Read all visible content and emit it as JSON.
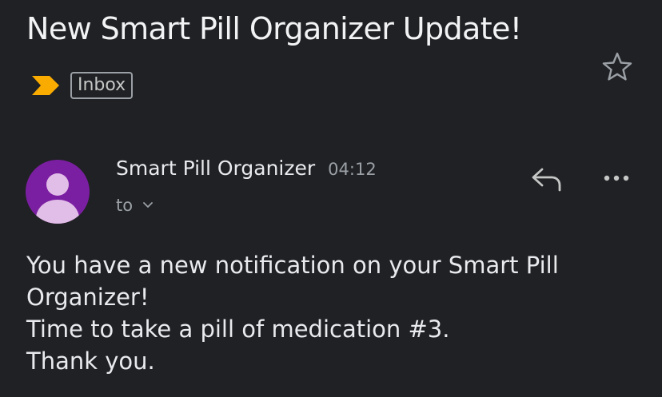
{
  "email": {
    "subject": "New Smart Pill Organizer Update!",
    "label": "Inbox",
    "sender": "Smart Pill Organizer",
    "time": "04:12",
    "recipient_prefix": "to",
    "body_lines": [
      "You have a new notification on your Smart Pill Organizer!",
      "Time to take a pill of medication #3.",
      "Thank you."
    ]
  },
  "icons": {
    "star": "star-outline-icon",
    "importance": "importance-marker-icon",
    "avatar": "person-avatar-icon",
    "reply": "reply-icon",
    "more": "more-horizontal-icon",
    "expand": "chevron-down-icon"
  },
  "colors": {
    "background": "#202124",
    "importance_marker": "#f9ab00",
    "avatar_bg": "#7b1fa2",
    "avatar_figure": "#e1bee7",
    "secondary_text": "#9aa0a6"
  }
}
